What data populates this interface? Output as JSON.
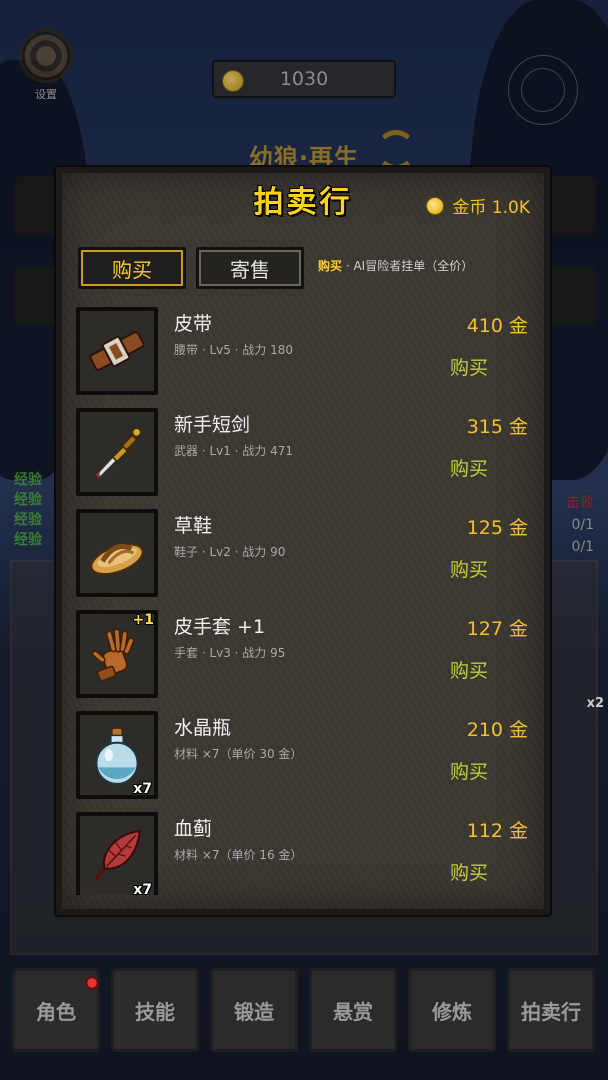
{
  "background": {
    "settings_label": "设置",
    "coin_value": "1030",
    "game_title": "幼狼·再生",
    "exp_labels": [
      "经验",
      "经验",
      "经验",
      "经验"
    ],
    "right_counts": [
      "0/1",
      "0/1"
    ],
    "right_red_label": "击败",
    "badge_x2": "x2",
    "tabs": [
      {
        "label": "角色",
        "has_notification": true
      },
      {
        "label": "技能"
      },
      {
        "label": "锻造"
      },
      {
        "label": "悬赏"
      },
      {
        "label": "修炼"
      },
      {
        "label": "拍卖行"
      }
    ]
  },
  "auction": {
    "title": "拍卖行",
    "gold_label": "金币 1.0K",
    "tab_buy": "购买",
    "tab_sell": "寄售",
    "hint_prefix": "购买",
    "hint_text": "· AI冒险者挂单（全价）",
    "buy_label": "购买",
    "items": [
      {
        "name": "皮带",
        "meta": "腰带 · Lv5 · 战力 180",
        "price": "410 金",
        "icon": "belt-icon",
        "badge": ""
      },
      {
        "name": "新手短剑",
        "meta": "武器 · Lv1 · 战力 471",
        "price": "315 金",
        "icon": "dagger-icon",
        "badge": ""
      },
      {
        "name": "草鞋",
        "meta": "鞋子 · Lv2 · 战力 90",
        "price": "125 金",
        "icon": "sandal-icon",
        "badge": ""
      },
      {
        "name": "皮手套 +1",
        "meta": "手套 · Lv3 · 战力 95",
        "price": "127 金",
        "icon": "glove-icon",
        "badge": "+1"
      },
      {
        "name": "水晶瓶",
        "meta": "材料 ×7（单价 30 金）",
        "price": "210 金",
        "icon": "crystal-bottle-icon",
        "badge": "x7"
      },
      {
        "name": "血蓟",
        "meta": "材料 ×7（单价 16 金）",
        "price": "112 金",
        "icon": "blood-thistle-icon",
        "badge": "x7"
      }
    ]
  },
  "colors": {
    "accent_gold": "#ffd21f",
    "price_gold": "#f2c12e",
    "buy_green": "#c3cf3c"
  }
}
